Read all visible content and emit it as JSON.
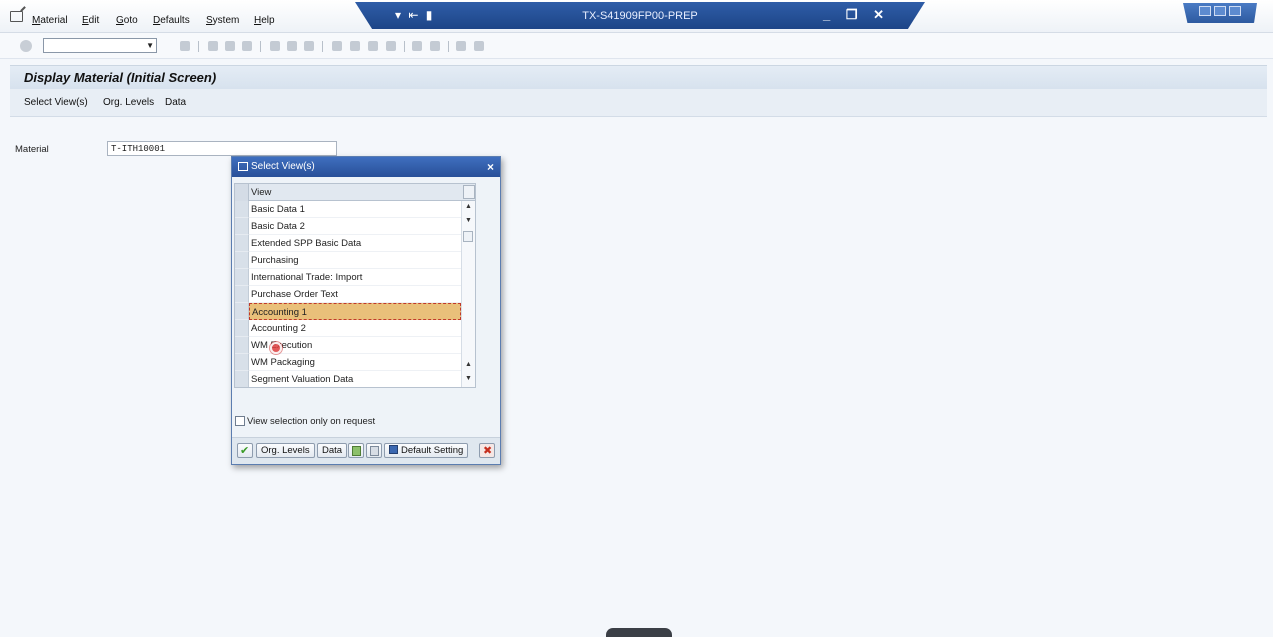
{
  "menu": {
    "items": [
      {
        "ul": "M",
        "rest": "aterial"
      },
      {
        "ul": "E",
        "rest": "dit"
      },
      {
        "ul": "G",
        "rest": "oto"
      },
      {
        "ul": "D",
        "rest": "efaults"
      },
      {
        "ul": "S",
        "rest": "ystem"
      },
      {
        "ul": "H",
        "rest": "elp"
      }
    ]
  },
  "window": {
    "title": "TX-S41909FP00-PREP"
  },
  "screen": {
    "title": "Display Material (Initial Screen)",
    "app_toolbar": [
      "Select View(s)",
      "Org. Levels",
      "Data"
    ]
  },
  "form": {
    "material_label": "Material",
    "material_value": "T-ITH10001"
  },
  "dialog": {
    "title": "Select View(s)",
    "column_header": "View",
    "rows": [
      "Basic Data 1",
      "Basic Data 2",
      "Extended SPP Basic Data",
      "Purchasing",
      "International Trade: Import",
      "Purchase Order Text",
      "Accounting 1",
      "Accounting 2",
      "WM Execution",
      "WM Packaging",
      "Segment Valuation Data"
    ],
    "selected_row": "Accounting 1",
    "checkbox_label": "View selection only on request",
    "buttons": {
      "org_levels": "Org. Levels",
      "data": "Data",
      "default_setting": "Default Setting"
    }
  }
}
